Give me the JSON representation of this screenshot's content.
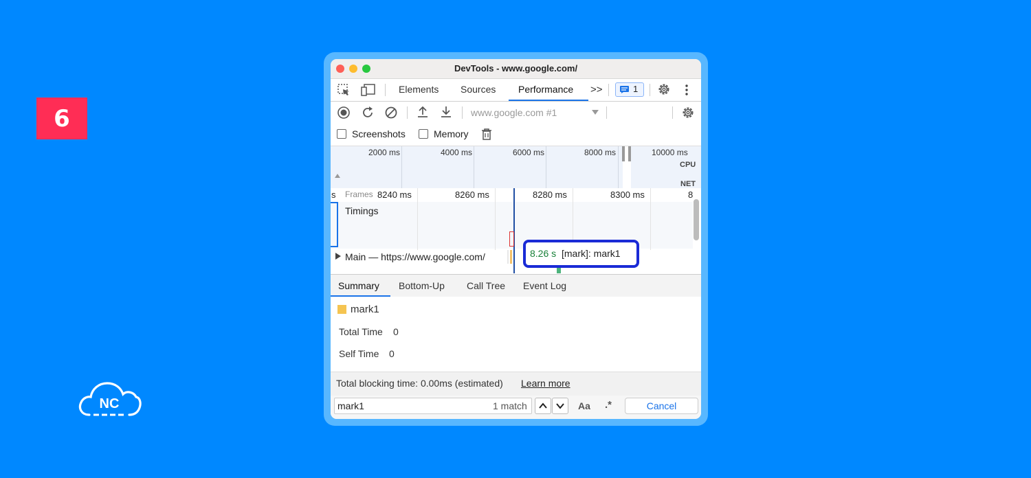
{
  "step_number": "6",
  "brand": {
    "logo_text": "NC"
  },
  "window": {
    "title": "DevTools - www.google.com/"
  },
  "tabs": {
    "items": [
      {
        "label": "Elements"
      },
      {
        "label": "Sources"
      },
      {
        "label": "Performance"
      }
    ],
    "active": "Performance",
    "more_label": ">>",
    "message_count": "1"
  },
  "toolbar": {
    "recording_selector": "www.google.com #1"
  },
  "options": {
    "screenshots_label": "Screenshots",
    "memory_label": "Memory"
  },
  "overview": {
    "ticks": [
      "2000 ms",
      "4000 ms",
      "6000 ms",
      "8000 ms",
      "10000 ms"
    ],
    "cpu_label": "CPU",
    "net_label": "NET"
  },
  "flame": {
    "left_edge": "s",
    "frames_label": "Frames",
    "ticks": [
      "8240 ms",
      "8260 ms",
      "8280 ms",
      "8300 ms",
      "8"
    ],
    "timings_label": "Timings",
    "main_label": "Main — https://www.google.com/",
    "tooltip": {
      "time": "8.26 s",
      "text": "[mark]: mark1"
    }
  },
  "bottom_tabs": {
    "items": [
      {
        "label": "Summary"
      },
      {
        "label": "Bottom-Up"
      },
      {
        "label": "Call Tree"
      },
      {
        "label": "Event Log"
      }
    ],
    "active": "Summary"
  },
  "summary": {
    "name": "mark1",
    "swatch_color": "#f5c451",
    "total_time_label": "Total Time",
    "total_time_value": "0",
    "self_time_label": "Self Time",
    "self_time_value": "0"
  },
  "footer": {
    "blocking_text": "Total blocking time: 0.00ms (estimated)",
    "learn_more": "Learn more"
  },
  "search": {
    "query": "mark1",
    "match_text": "1 match",
    "case_label": "Aa",
    "regex_label": ".*",
    "cancel_label": "Cancel"
  },
  "colors": {
    "background": "#0088ff",
    "badge": "#ff2d55",
    "accent": "#1a73e8",
    "highlight": "#1a2bd6"
  }
}
